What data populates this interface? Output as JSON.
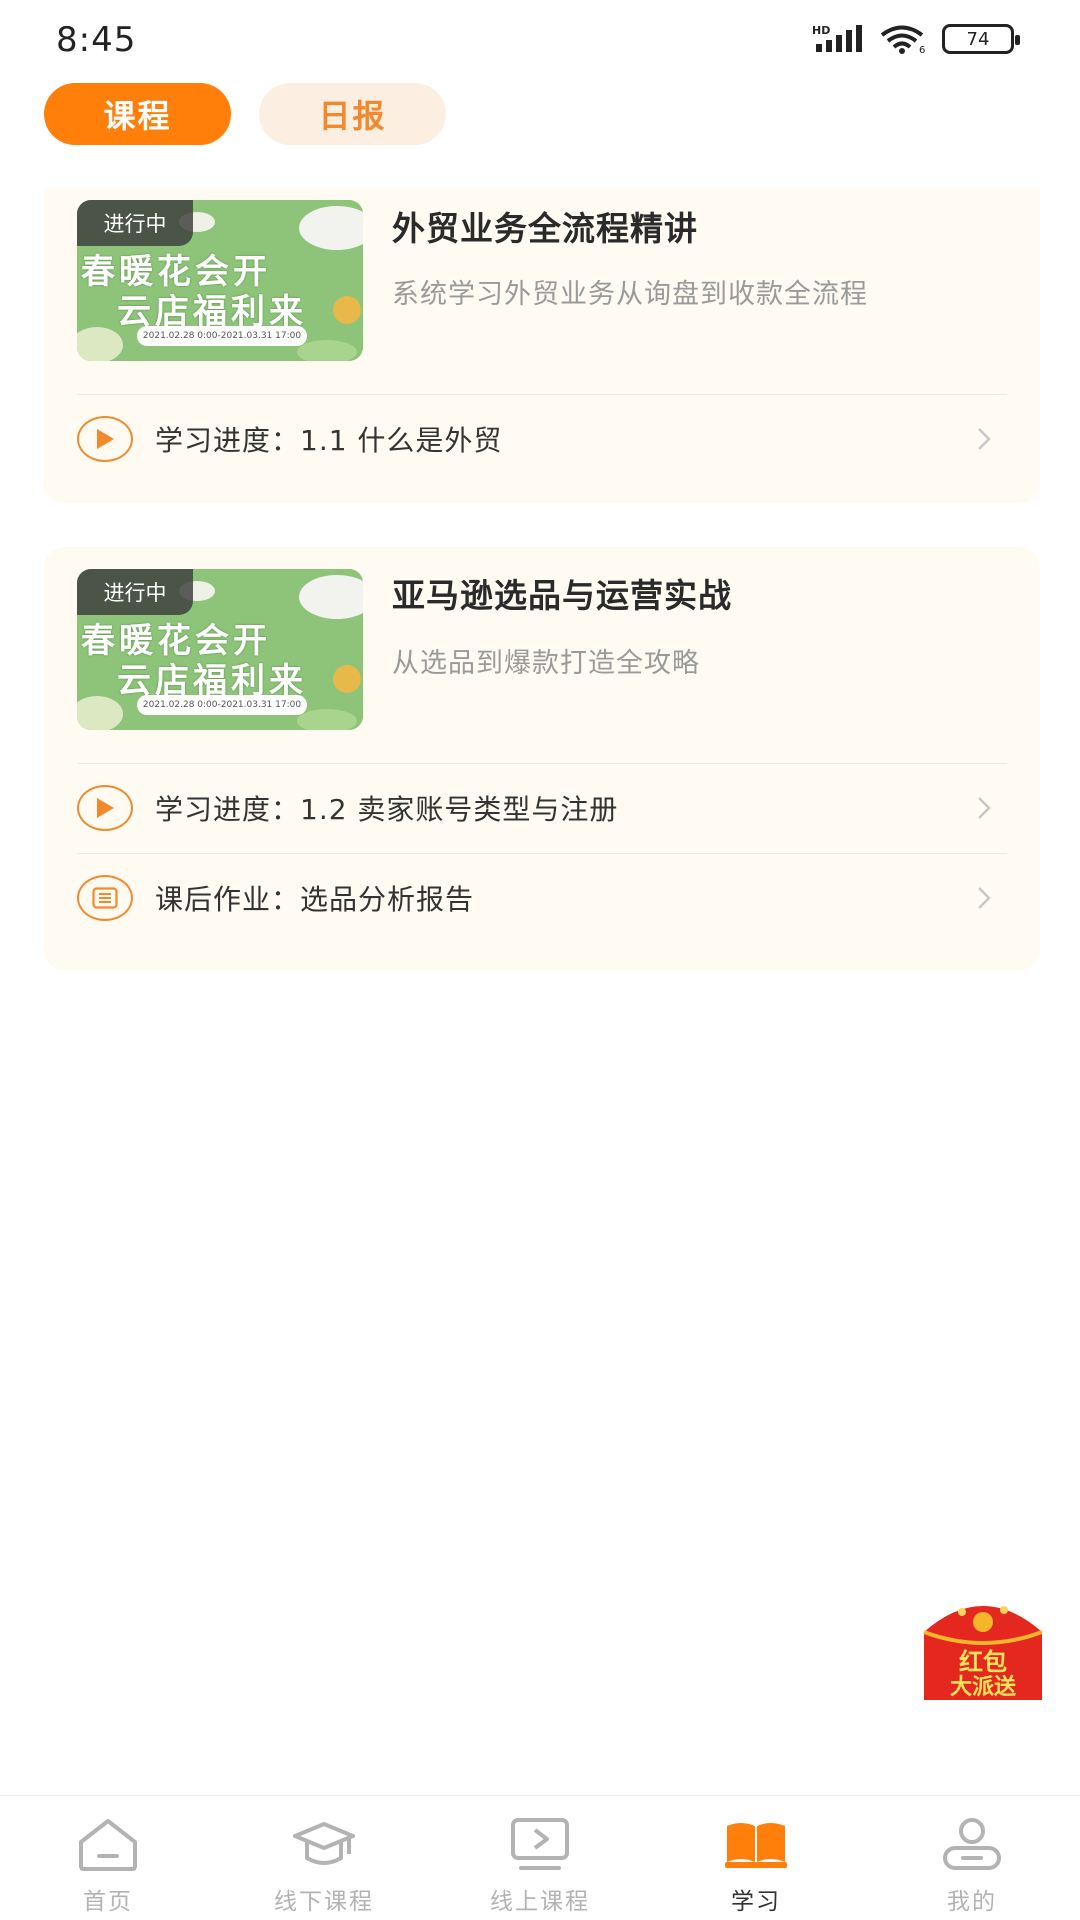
{
  "status_bar": {
    "time": "8:45",
    "battery": "74",
    "network": "HD",
    "wifi_badge": "6"
  },
  "tabs": [
    {
      "label": "课程",
      "active": true
    },
    {
      "label": "日报",
      "active": false
    }
  ],
  "courses": [
    {
      "badge": "进行中",
      "thumb_line1": "春暖花会开",
      "thumb_line2": "云店福利来",
      "thumb_date": "2021.02.28 0:00-2021.03.31 17:00",
      "title": "外贸业务全流程精讲",
      "description": "系统学习外贸业务从询盘到收款全流程",
      "progress_label": "学习进度：1.1 什么是外贸"
    },
    {
      "badge": "进行中",
      "thumb_line1": "春暖花会开",
      "thumb_line2": "云店福利来",
      "thumb_date": "2021.02.28 0:00-2021.03.31 17:00",
      "title": "亚马逊选品与运营实战",
      "description": "从选品到爆款打造全攻略",
      "progress_label": "学习进度：1.2 卖家账号类型与注册",
      "homework_label": "课后作业：选品分析报告"
    }
  ],
  "red_packet": {
    "line1": "红包",
    "line2": "大派送"
  },
  "bottom_nav": [
    {
      "label": "首页",
      "icon": "home-icon",
      "active": false
    },
    {
      "label": "线下课程",
      "icon": "graduation-cap-icon",
      "active": false
    },
    {
      "label": "线上课程",
      "icon": "video-play-icon",
      "active": false
    },
    {
      "label": "学习",
      "icon": "book-icon",
      "active": true
    },
    {
      "label": "我的",
      "icon": "user-icon",
      "active": false
    }
  ],
  "colors": {
    "accent": "#FF7F0A",
    "card_bg": "#FFFBF2",
    "inactive_tab_bg": "#FDEEE2"
  }
}
